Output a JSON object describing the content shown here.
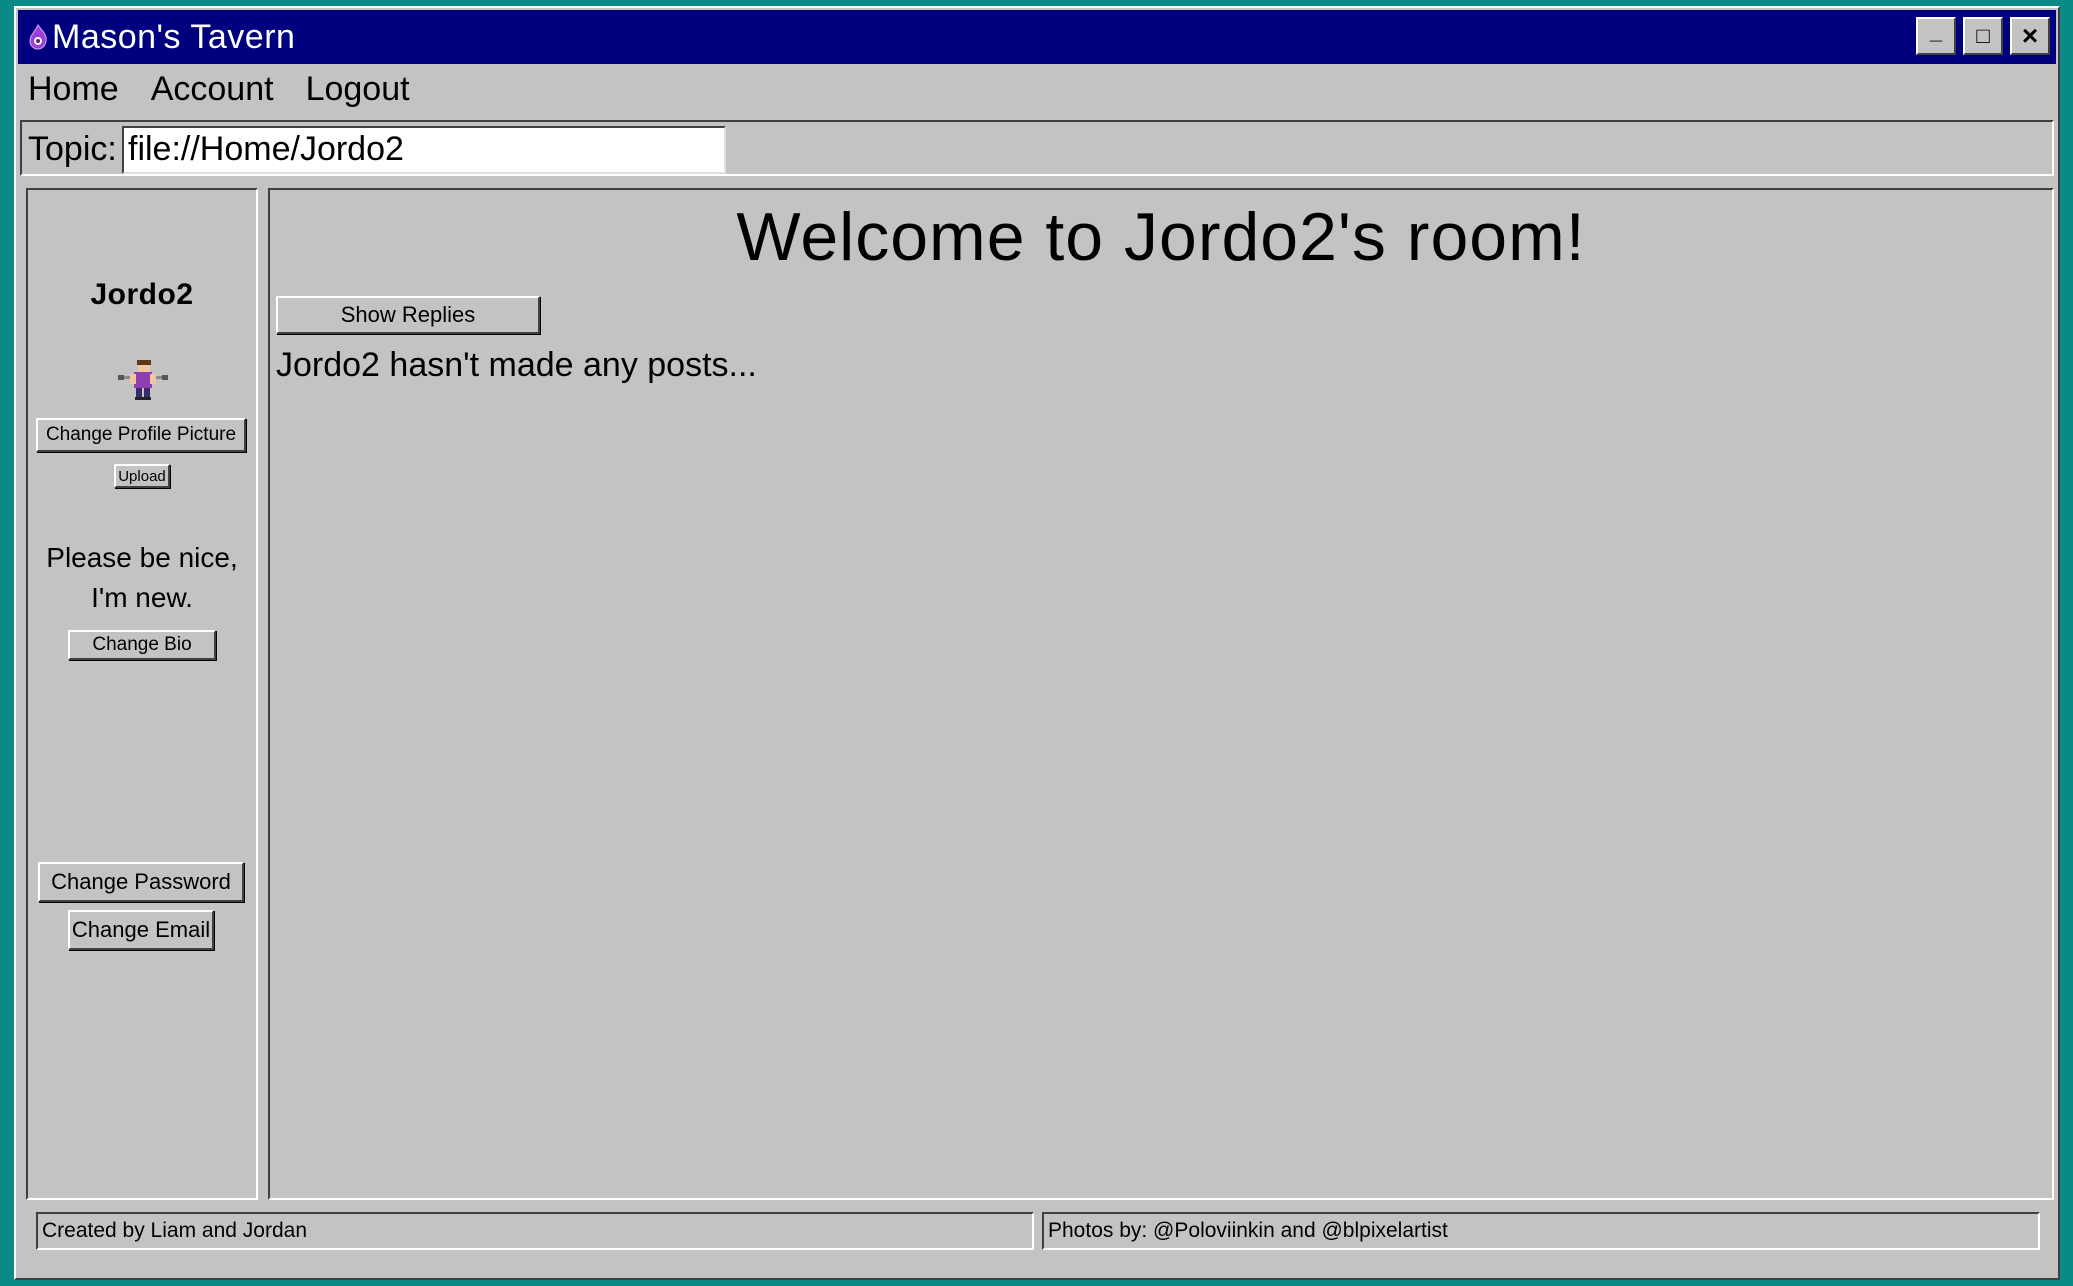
{
  "window": {
    "title": "Mason's Tavern",
    "buttons": {
      "minimize": "_",
      "maximize": "□",
      "close": "×"
    }
  },
  "menu": {
    "items": [
      "Home",
      "Account",
      "Logout"
    ]
  },
  "topic": {
    "label": "Topic:",
    "value": "file://Home/Jordo2"
  },
  "sidebar": {
    "username": "Jordo2",
    "change_picture_label": "Change Profile Picture",
    "upload_label": "Upload",
    "bio_line1": "Please be nice,",
    "bio_line2": "I'm new.",
    "change_bio_label": "Change Bio",
    "change_password_label": "Change Password",
    "change_email_label": "Change Email"
  },
  "main": {
    "heading": "Welcome to Jordo2's room!",
    "show_replies_label": "Show Replies",
    "empty_message": "Jordo2 hasn't made any posts..."
  },
  "status": {
    "left": "Created by Liam and Jordan",
    "right": "Photos by: @Poloviinkin and @blpixelartist"
  },
  "colors": {
    "desktop": "#0a8a86",
    "titlebar": "#00007f",
    "window_face": "#c3c3c3"
  },
  "icons": {
    "app": "purple-flame-icon",
    "avatar": "pixel-character-avatar"
  }
}
